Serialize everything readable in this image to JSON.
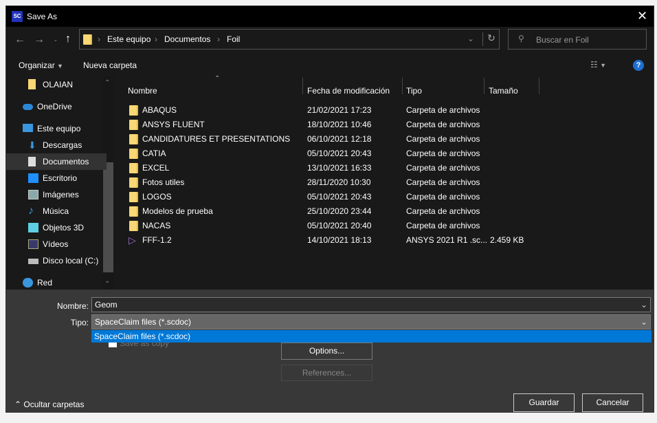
{
  "title": "Save As",
  "app_icon_text": "SC",
  "breadcrumb": [
    "Este equipo",
    "Documentos",
    "Foil"
  ],
  "search_placeholder": "Buscar en Foil",
  "toolbar": {
    "organize": "Organizar",
    "new_folder": "Nueva carpeta"
  },
  "sidebar": [
    {
      "label": "OLAIAN",
      "icon": "folder-icon"
    },
    {
      "label": "OneDrive",
      "icon": "cloud-icon"
    },
    {
      "label": "Este equipo",
      "icon": "computer-icon"
    },
    {
      "label": "Descargas",
      "icon": "download-icon"
    },
    {
      "label": "Documentos",
      "icon": "document-icon",
      "selected": true
    },
    {
      "label": "Escritorio",
      "icon": "desktop-icon"
    },
    {
      "label": "Imágenes",
      "icon": "image-icon"
    },
    {
      "label": "Música",
      "icon": "music-icon"
    },
    {
      "label": "Objetos 3D",
      "icon": "cube-icon"
    },
    {
      "label": "Vídeos",
      "icon": "video-icon"
    },
    {
      "label": "Disco local (C:)",
      "icon": "drive-icon"
    },
    {
      "label": "Red",
      "icon": "network-icon"
    }
  ],
  "columns": [
    "Nombre",
    "Fecha de modificación",
    "Tipo",
    "Tamaño"
  ],
  "files": [
    {
      "name": "ABAQUS",
      "date": "21/02/2021 17:23",
      "type": "Carpeta de archivos",
      "size": ""
    },
    {
      "name": "ANSYS FLUENT",
      "date": "18/10/2021 10:46",
      "type": "Carpeta de archivos",
      "size": ""
    },
    {
      "name": "CANDIDATURES ET PRESENTATIONS",
      "date": "06/10/2021 12:18",
      "type": "Carpeta de archivos",
      "size": ""
    },
    {
      "name": "CATIA",
      "date": "05/10/2021 20:43",
      "type": "Carpeta de archivos",
      "size": ""
    },
    {
      "name": "EXCEL",
      "date": "13/10/2021 16:33",
      "type": "Carpeta de archivos",
      "size": ""
    },
    {
      "name": "Fotos utiles",
      "date": "28/11/2020 10:30",
      "type": "Carpeta de archivos",
      "size": ""
    },
    {
      "name": "LOGOS",
      "date": "05/10/2021 20:43",
      "type": "Carpeta de archivos",
      "size": ""
    },
    {
      "name": "Modelos de prueba",
      "date": "25/10/2020 23:44",
      "type": "Carpeta de archivos",
      "size": ""
    },
    {
      "name": "NACAS",
      "date": "05/10/2021 20:40",
      "type": "Carpeta de archivos",
      "size": ""
    },
    {
      "name": "FFF-1.2",
      "date": "14/10/2021 18:13",
      "type": "ANSYS 2021 R1 .sc...",
      "size": "2.459 KB",
      "file": true
    }
  ],
  "form": {
    "name_label": "Nombre:",
    "name_value": "Geom",
    "type_label": "Tipo:",
    "type_value": "SpaceClaim files (*.scdoc)",
    "type_option": "SpaceClaim files (*.scdoc)",
    "save_copy": "Save as copy",
    "options": "Options...",
    "references": "References..."
  },
  "hide_folders": "Ocultar carpetas",
  "save": "Guardar",
  "cancel": "Cancelar",
  "colors": {
    "accent": "#0078d7"
  }
}
